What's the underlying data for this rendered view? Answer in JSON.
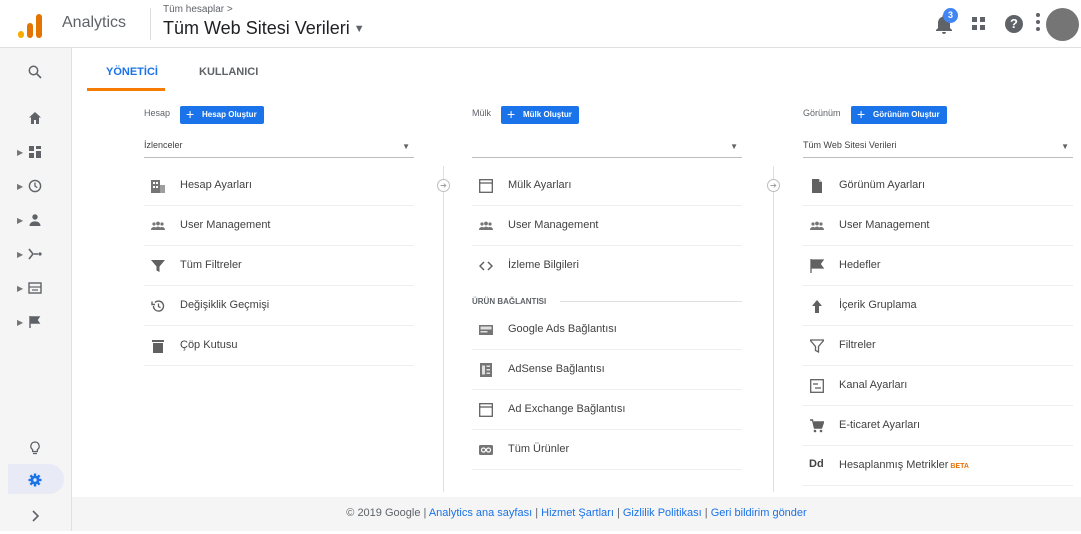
{
  "header": {
    "app_name": "Analytics",
    "breadcrumb": "Tüm hesaplar >",
    "property_name": "Tüm Web Sitesi Verileri",
    "notification_count": "3",
    "help_label": "?",
    "logo_colors": [
      "#f9ab00",
      "#e37400",
      "#e37400"
    ]
  },
  "tabs": {
    "admin": "YÖNETİCİ",
    "user": "KULLANICI"
  },
  "columns": {
    "account": {
      "heading": "Hesap",
      "create_label": "Hesap Oluştur",
      "selected": "İzlenceler",
      "items": [
        {
          "label": "Hesap Ayarları",
          "icon": "building-icon"
        },
        {
          "label": "User Management",
          "icon": "people-icon"
        },
        {
          "label": "Tüm Filtreler",
          "icon": "filter-icon"
        },
        {
          "label": "Değişiklik Geçmişi",
          "icon": "history-icon"
        },
        {
          "label": "Çöp Kutusu",
          "icon": "trash-icon"
        }
      ]
    },
    "property": {
      "heading": "Mülk",
      "create_label": "Mülk Oluştur",
      "selected": "",
      "items": [
        {
          "label": "Mülk Ayarları",
          "icon": "window-icon"
        },
        {
          "label": "User Management",
          "icon": "people-icon"
        },
        {
          "label": "İzleme Bilgileri",
          "icon": "code-icon"
        }
      ],
      "section": "ÜRÜN BAĞLANTISI",
      "links": [
        {
          "label": "Google Ads Bağlantısı",
          "icon": "ads-icon"
        },
        {
          "label": "AdSense Bağlantısı",
          "icon": "adsense-icon"
        },
        {
          "label": "Ad Exchange Bağlantısı",
          "icon": "window-icon"
        },
        {
          "label": "Tüm Ürünler",
          "icon": "products-icon"
        }
      ]
    },
    "view": {
      "heading": "Görünüm",
      "create_label": "Görünüm Oluştur",
      "selected": "Tüm Web Sitesi Verileri",
      "items": [
        {
          "label": "Görünüm Ayarları",
          "icon": "document-icon"
        },
        {
          "label": "User Management",
          "icon": "people-icon"
        },
        {
          "label": "Hedefler",
          "icon": "flag-icon"
        },
        {
          "label": "İçerik Gruplama",
          "icon": "person-walk-icon"
        },
        {
          "label": "Filtreler",
          "icon": "filter-icon"
        },
        {
          "label": "Kanal Ayarları",
          "icon": "channel-icon"
        },
        {
          "label": "E-ticaret Ayarları",
          "icon": "cart-icon"
        },
        {
          "label": "Hesaplanmış Metrikler",
          "icon": "dd-icon",
          "badge": "BETA",
          "icon_text": "Dd"
        }
      ]
    }
  },
  "footer": {
    "copyright": "© 2019 Google |",
    "links": [
      "Analytics ana sayfası",
      "Hizmet Şartları",
      "Gizlilik Politikası",
      "Geri bildirim gönder"
    ],
    "separator": "|"
  },
  "colors": {
    "accent": "#1a73e8",
    "tab_underline": "#f57c00",
    "beta": "#e8710a"
  }
}
